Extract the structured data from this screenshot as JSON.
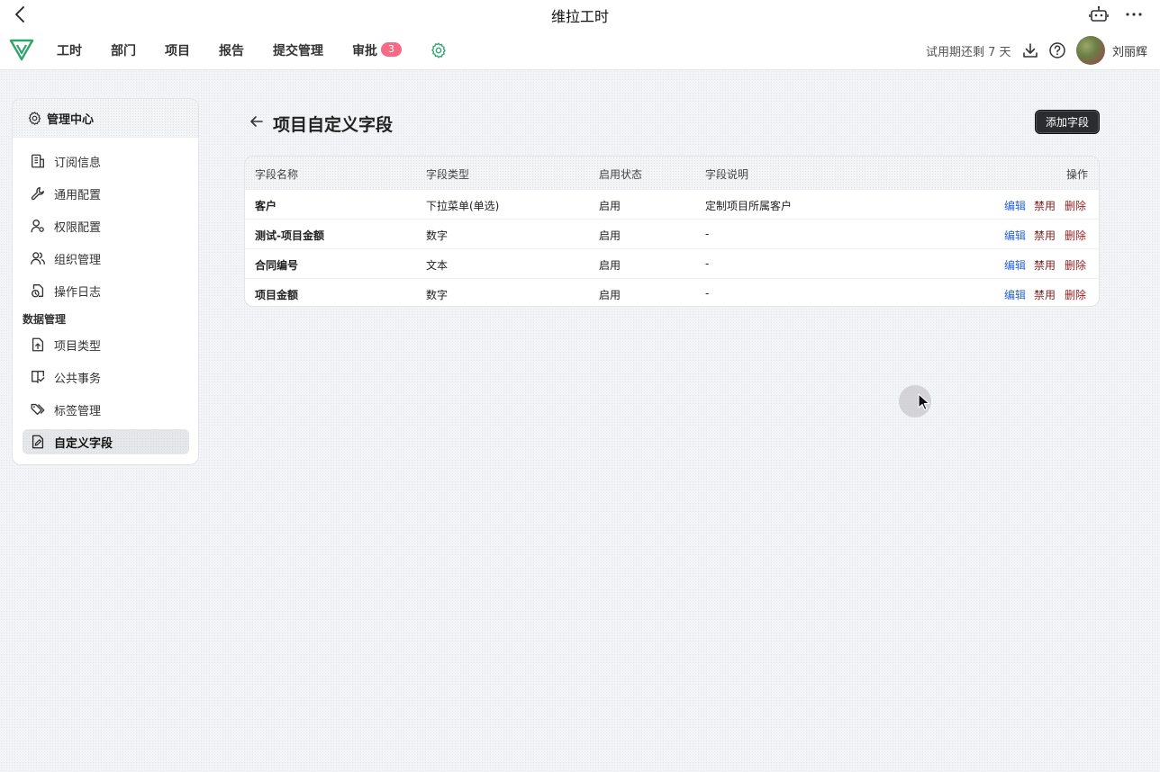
{
  "titlebar": {
    "title": "维拉工时",
    "back_icon": "chevron-left-icon",
    "robot_icon": "robot-icon",
    "more_icon": "more-dots-icon"
  },
  "nav": {
    "logo": "v-logo",
    "items": [
      "工时",
      "部门",
      "项目",
      "报告",
      "提交管理",
      "审批"
    ],
    "approval_badge": "3",
    "trial_text": "试用期还剩 7 天",
    "user_name": "刘丽辉",
    "accent_color": "#2fa46e",
    "badge_color": "#f56b85"
  },
  "sidebar": {
    "header": "管理中心",
    "items_top": [
      {
        "label": "订阅信息",
        "icon": "building-icon"
      },
      {
        "label": "通用配置",
        "icon": "wrench-icon"
      },
      {
        "label": "权限配置",
        "icon": "user-settings-icon"
      },
      {
        "label": "组织管理",
        "icon": "users-icon"
      },
      {
        "label": "操作日志",
        "icon": "file-clock-icon"
      }
    ],
    "section": "数据管理",
    "items_data": [
      {
        "label": "项目类型",
        "icon": "file-upload-icon"
      },
      {
        "label": "公共事务",
        "icon": "book-check-icon"
      },
      {
        "label": "标签管理",
        "icon": "tags-icon"
      },
      {
        "label": "自定义字段",
        "icon": "file-edit-icon"
      }
    ]
  },
  "main": {
    "title": "项目自定义字段",
    "add_button": "添加字段",
    "columns": [
      "字段名称",
      "字段类型",
      "启用状态",
      "字段说明",
      "操作"
    ],
    "actions": {
      "edit": "编辑",
      "disable": "禁用",
      "delete": "删除"
    },
    "rows": [
      {
        "name": "客户",
        "type": "下拉菜单(单选)",
        "status": "启用",
        "desc": "定制项目所属客户"
      },
      {
        "name": "测试-项目金额",
        "type": "数字",
        "status": "启用",
        "desc": "-"
      },
      {
        "name": "合同编号",
        "type": "文本",
        "status": "启用",
        "desc": "-"
      },
      {
        "name": "项目金额",
        "type": "数字",
        "status": "启用",
        "desc": "-"
      }
    ]
  }
}
